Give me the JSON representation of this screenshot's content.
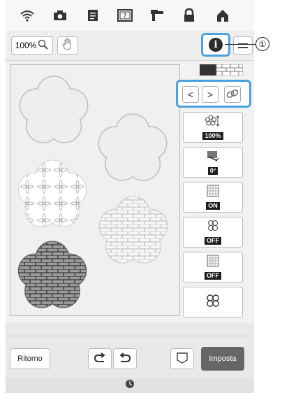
{
  "status_bar": {
    "icons": [
      "wifi-icon",
      "camera-icon",
      "document-icon",
      "help-icon",
      "stitch-icon",
      "lock-icon",
      "home-icon"
    ]
  },
  "toolbar": {
    "zoom_value": "100%",
    "zoom_icon": "magnifier-icon",
    "hand_icon": "hand-icon",
    "info_icon": "i",
    "menu_icon": "menu-icon"
  },
  "callout": {
    "number": "①"
  },
  "selection_nav": {
    "prev_label": "<",
    "next_label": ">",
    "link_icon": "chain-link-icon"
  },
  "tools": [
    {
      "name": "size",
      "badge": "100%"
    },
    {
      "name": "rotate",
      "badge": "0°"
    },
    {
      "name": "outline-on",
      "badge": "ON"
    },
    {
      "name": "multi-select",
      "badge": "OFF"
    },
    {
      "name": "pattern",
      "badge": "OFF"
    },
    {
      "name": "group",
      "badge": ""
    }
  ],
  "bottom": {
    "back_label": "Ritorno",
    "set_label": "Imposta"
  },
  "colors": {
    "highlight": "#4aa3df",
    "set_button": "#666666"
  }
}
